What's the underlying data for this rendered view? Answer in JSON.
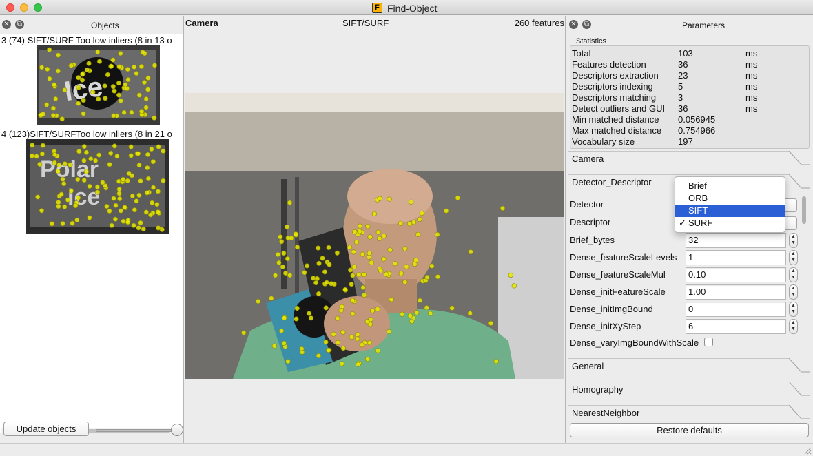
{
  "window": {
    "title": "Find-Object",
    "app_icon_letter": "F"
  },
  "objects_panel": {
    "header": "Objects",
    "objects": [
      {
        "title": "3 (74) SIFT/SURF Too low inliers (8 in 13 o"
      },
      {
        "title": "4 (123)SIFT/SURFToo low inliers (8 in 21 o"
      }
    ],
    "update_button": "Update objects"
  },
  "camera_panel": {
    "label": "Camera",
    "algorithm": "SIFT/SURF",
    "features": "260 features"
  },
  "parameters_panel": {
    "header": "Parameters",
    "statistics_title": "Statistics",
    "statistics": [
      {
        "name": "Total",
        "value": "103",
        "unit": "ms"
      },
      {
        "name": "Features detection",
        "value": "36",
        "unit": "ms"
      },
      {
        "name": "Descriptors extraction",
        "value": "23",
        "unit": "ms"
      },
      {
        "name": "Descriptors indexing",
        "value": "5",
        "unit": "ms"
      },
      {
        "name": "Descriptors matching",
        "value": "3",
        "unit": "ms"
      },
      {
        "name": "Detect outliers and GUI",
        "value": "36",
        "unit": "ms"
      },
      {
        "name": "Min matched distance",
        "value": "0.056945",
        "unit": ""
      },
      {
        "name": "Max matched distance",
        "value": "0.754966",
        "unit": ""
      },
      {
        "name": "Vocabulary size",
        "value": "197",
        "unit": ""
      }
    ],
    "sections": {
      "camera": "Camera",
      "detector_descriptor": "Detector_Descriptor",
      "general": "General",
      "homography": "Homography",
      "nearest_neighbor": "NearestNeighbor"
    },
    "params": {
      "detector_label": "Detector",
      "descriptor_label": "Descriptor",
      "brief_bytes_label": "Brief_bytes",
      "brief_bytes_value": "32",
      "dense_feature_scale_levels_label": "Dense_featureScaleLevels",
      "dense_feature_scale_levels_value": "1",
      "dense_feature_scale_mul_label": "Dense_featureScaleMul",
      "dense_feature_scale_mul_value": "0.10",
      "dense_init_feature_scale_label": "Dense_initFeatureScale",
      "dense_init_feature_scale_value": "1.00",
      "dense_init_img_bound_label": "Dense_initImgBound",
      "dense_init_img_bound_value": "0",
      "dense_init_xy_step_label": "Dense_initXyStep",
      "dense_init_xy_step_value": "6",
      "dense_vary_img_bound_label": "Dense_varyImgBoundWithScale"
    },
    "dropdown_options": [
      "Brief",
      "ORB",
      "SIFT",
      "SURF"
    ],
    "dropdown_highlighted": "SIFT",
    "dropdown_checked": "SURF",
    "restore_button": "Restore defaults"
  },
  "colors": {
    "keypoint": "#e8e800",
    "selection": "#2a5fd6"
  }
}
